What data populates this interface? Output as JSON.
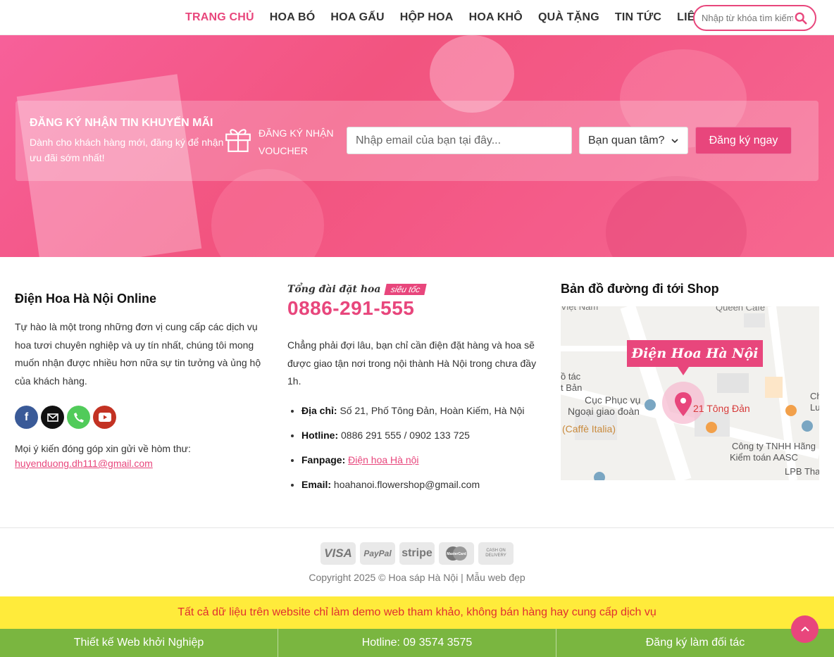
{
  "nav": {
    "items": [
      {
        "label": "TRANG CHỦ",
        "active": true
      },
      {
        "label": "HOA BÓ"
      },
      {
        "label": "HOA GẤU"
      },
      {
        "label": "HỘP HOA"
      },
      {
        "label": "HOA KHÔ"
      },
      {
        "label": "QUÀ TẶNG"
      },
      {
        "label": "TIN TỨC"
      },
      {
        "label": "LIÊN HỆ"
      }
    ],
    "search_placeholder": "Nhập từ khóa tìm kiếm..."
  },
  "signup": {
    "title": "ĐĂNG KÝ NHẬN TIN KHUYẾN MÃI",
    "desc": "Dành cho khách hàng mới, đăng ký để nhận ưu đãi sớm nhất!",
    "voucher": "ĐĂNG KÝ NHẬN VOUCHER",
    "email_placeholder": "Nhập email của bạn tại đây...",
    "select_value": "Bạn quan tâm?",
    "button": "Đăng ký ngay"
  },
  "about": {
    "title": "Điện Hoa Hà Nội Online",
    "text": "Tự hào là một trong những đơn vị cung cấp các dịch vụ hoa tươi chuyên nghiệp và uy tín nhất, chúng tôi mong muốn nhận được nhiều hơn nữa sự tin tưởng và ủng hộ của khách hàng.",
    "feedback": "Mọi ý kiến đóng góp xin gửi về hòm thư:",
    "email": "huyenduong.dh111@gmail.com"
  },
  "contact": {
    "hotline_small": "Tổng đài đặt hoa",
    "hotline_tag": "siêu tốc",
    "hotline_number": "0886-291-555",
    "intro": "Chẳng phải đợi lâu, bạn chỉ cần điện đặt hàng và hoa sẽ được giao tận nơi trong nội thành Hà Nội trong chưa đầy 1h.",
    "address_label": "Địa chỉ:",
    "address": "Số 21, Phố Tông Đản, Hoàn Kiếm, Hà Nội",
    "hotline_label": "Hotline:",
    "hotline": "0886 291 555 / 0902 133 725",
    "fanpage_label": "Fanpage:",
    "fanpage": "Điện hoa Hà nội",
    "email_label": "Email:",
    "email": "hoahanoi.flowershop@gmail.com"
  },
  "map": {
    "title": "Bản đồ đường đi tới Shop",
    "pin_label": "Điện Hoa Hà Nội",
    "street": "21 Tông Đản",
    "label_viet_nam": "Việt Nam",
    "label_queen": "Queen Cafe",
    "label_tac": "ồ tác",
    "label_ban": "t Bản",
    "label_cuc": "Cục Phục vụ",
    "label_ngoai": "Ngoại giao đoàn",
    "label_caffe": "(Caffè Italia)",
    "label_cong_ty": "Công ty TNHH Hãng",
    "label_kiem_toan": "Kiểm toán AASC",
    "label_lpb": "LPB Tha",
    "label_ch": "Ch",
    "label_lu": "Lu"
  },
  "payments": [
    "VISA",
    "PayPal",
    "stripe",
    "MasterCard",
    "CASH ON DELIVERY"
  ],
  "copyright": "Copyright 2025 © Hoa sáp Hà Nội | Mẫu web đẹp",
  "notice": "Tất cả dữ liệu trên website chỉ làm demo web tham khảo, không bán hàng hay cung cấp dịch vụ",
  "bottom_bar": [
    "Thiết kế Web khởi Nghiệp",
    "Hotline: 09 3574 3575",
    "Đăng ký làm đối tác"
  ],
  "colors": {
    "accent": "#e8467c",
    "notice_bg": "#ffeb3b",
    "bar_bg": "#7ab640"
  }
}
